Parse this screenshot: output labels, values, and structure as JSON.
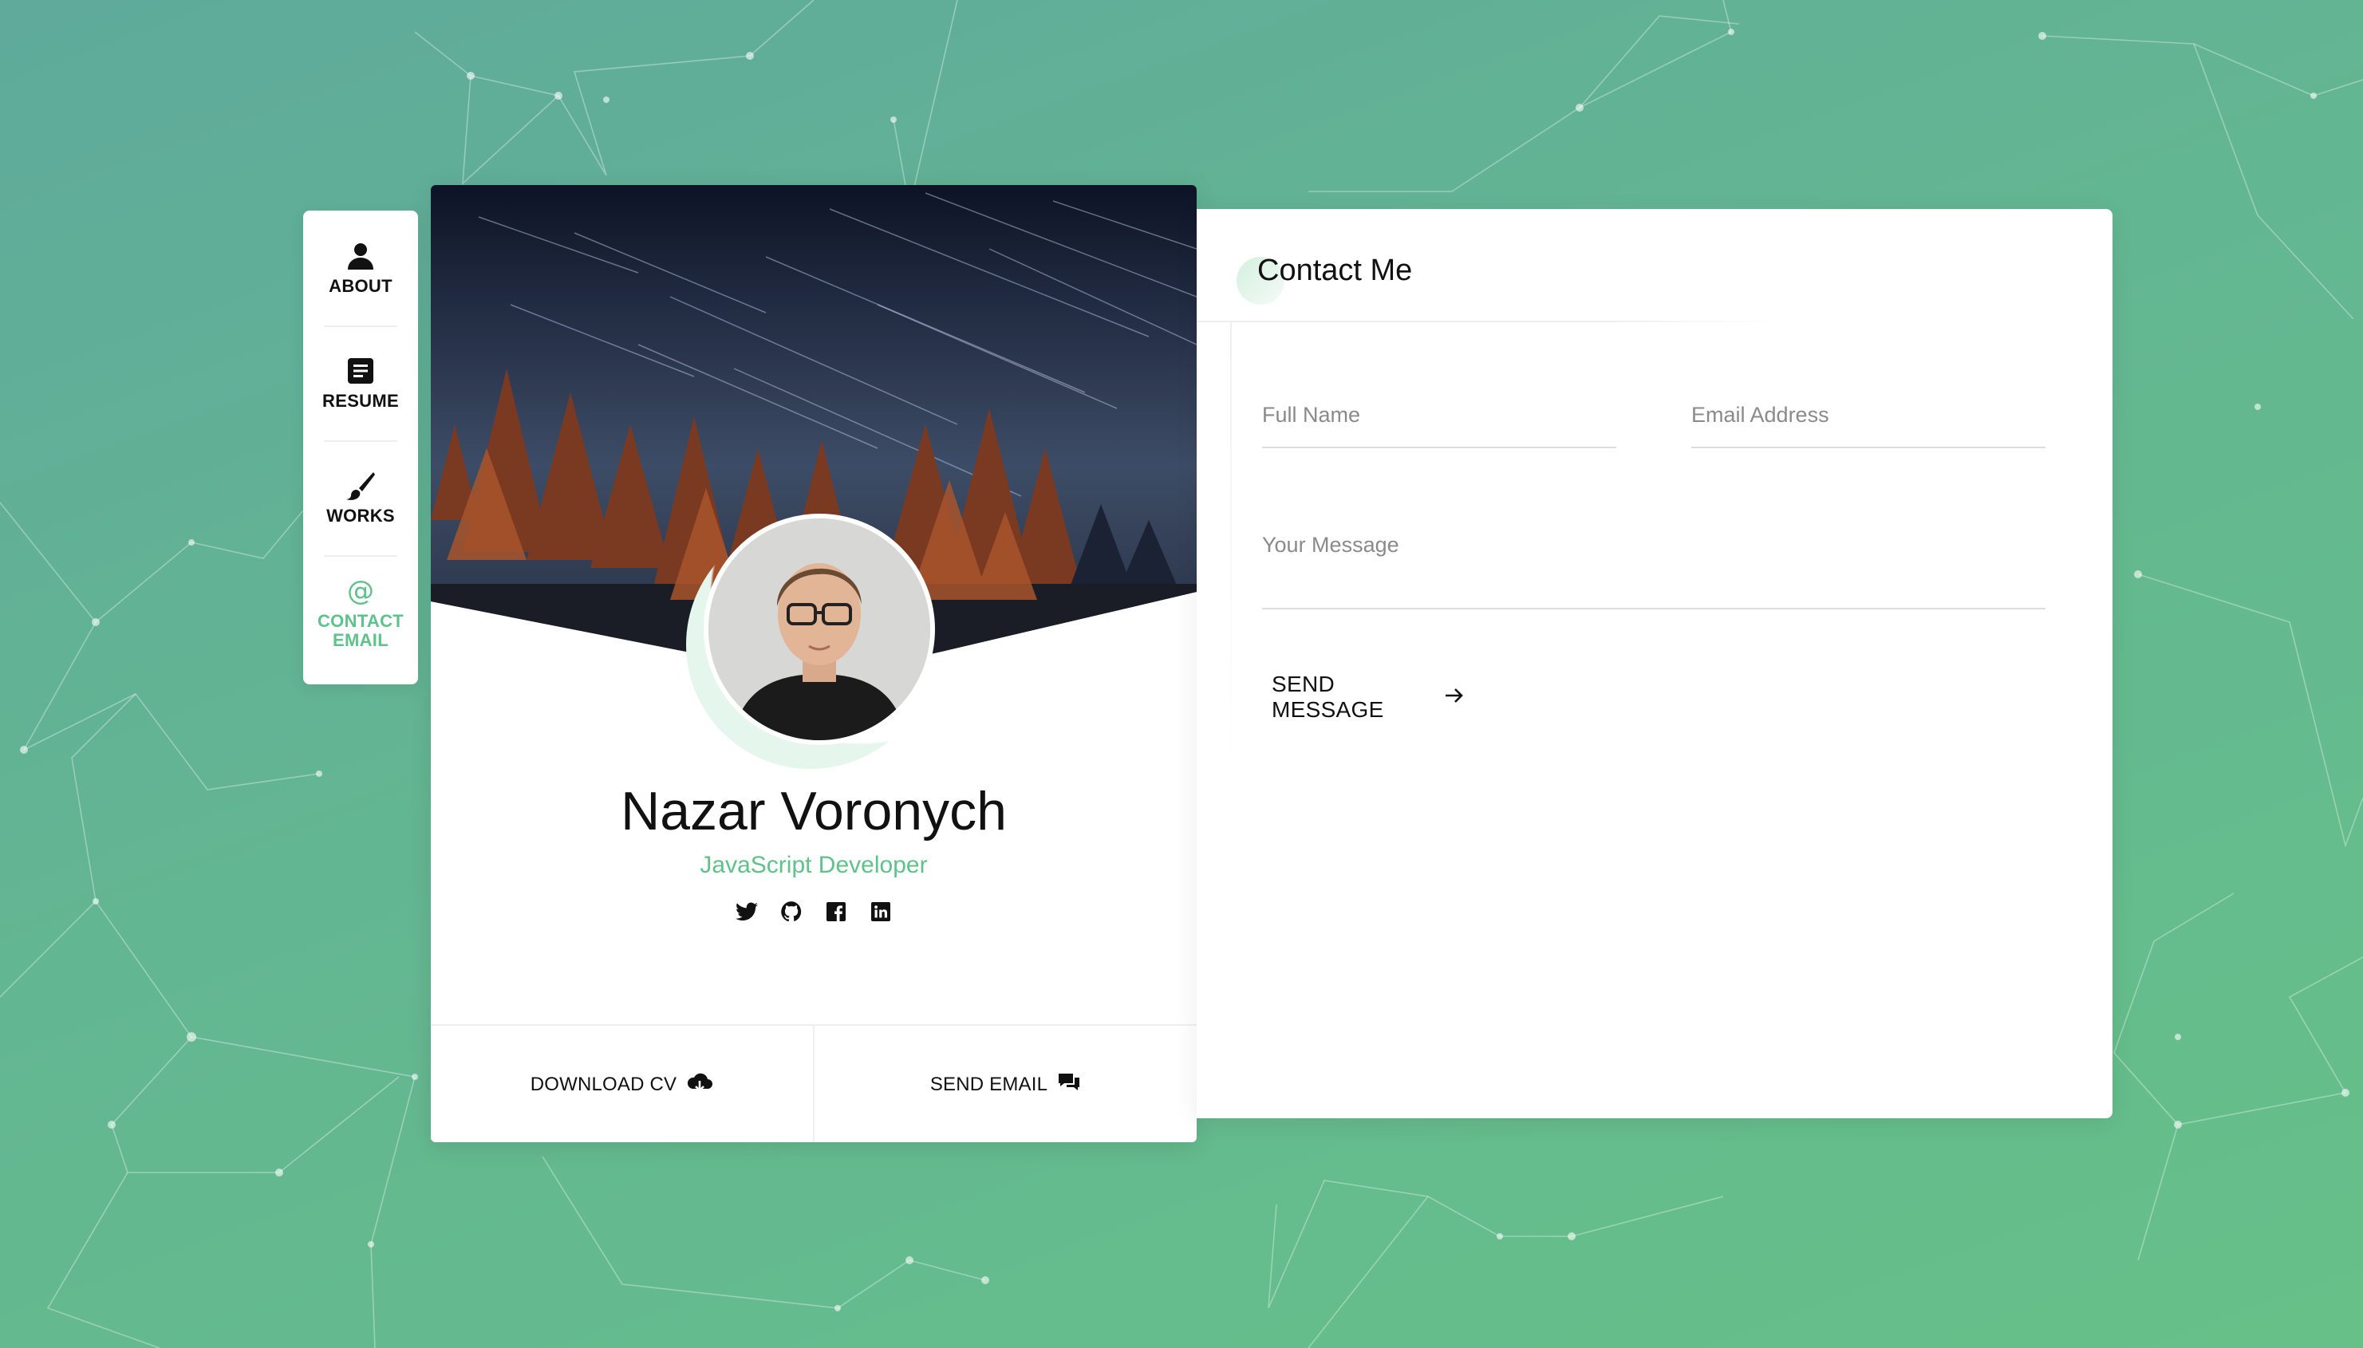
{
  "nav": {
    "items": [
      {
        "label": "ABOUT",
        "icon": "user-icon"
      },
      {
        "label": "RESUME",
        "icon": "document-icon"
      },
      {
        "label": "WORKS",
        "icon": "brush-icon"
      },
      {
        "label": "CONTACT EMAIL",
        "icon": "at-icon",
        "active": true
      }
    ],
    "contact_icon_glyph": "@"
  },
  "profile": {
    "name": "Nazar Voronych",
    "role": "JavaScript Developer",
    "socials": [
      "twitter-icon",
      "github-icon",
      "facebook-icon",
      "linkedin-icon"
    ],
    "download_cv_label": "DOWNLOAD CV",
    "send_email_label": "SEND EMAIL"
  },
  "contact": {
    "title": "Contact Me",
    "full_name_placeholder": "Full Name",
    "email_placeholder": "Email Address",
    "message_placeholder": "Your Message",
    "send_label": "SEND MESSAGE"
  },
  "colors": {
    "accent": "#5fc28a",
    "background_start": "#5faa9b",
    "background_end": "#66c088"
  }
}
